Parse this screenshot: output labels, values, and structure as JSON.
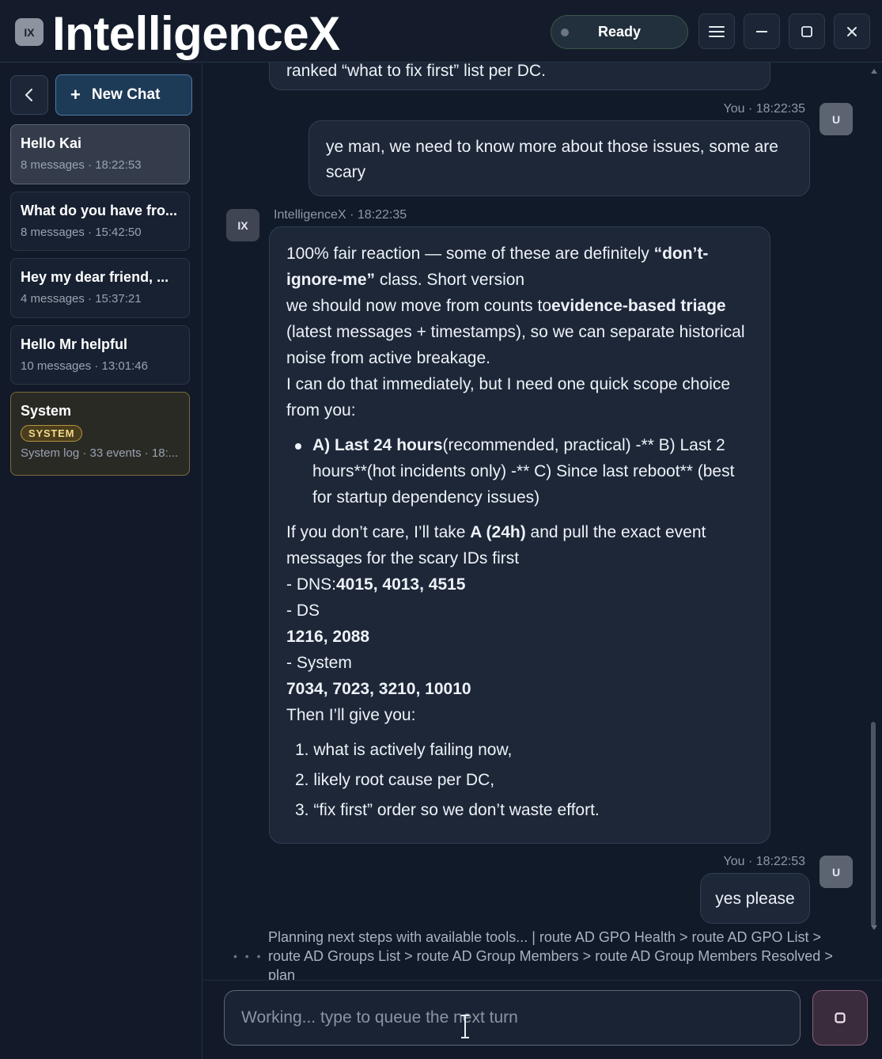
{
  "app": {
    "badge": "IX",
    "title": "IntelligenceX"
  },
  "status": {
    "label": "Ready"
  },
  "window_controls": [
    "menu-icon",
    "minimize-icon",
    "maximize-icon",
    "close-icon"
  ],
  "sidebar": {
    "back_icon": "chevron-left-icon",
    "new_chat_label": "New Chat",
    "chats": [
      {
        "title": "Hello Kai",
        "meta": "8 messages · 18:22:53",
        "active": true
      },
      {
        "title": "What do you have fro...",
        "meta": "8 messages · 15:42:50"
      },
      {
        "title": "Hey my dear friend, ...",
        "meta": "4 messages · 15:37:21"
      },
      {
        "title": "Hello Mr helpful",
        "meta": "10 messages · 13:01:46"
      },
      {
        "title": "System",
        "badge": "SYSTEM",
        "meta": "System log · 33 events · 18:..."
      }
    ]
  },
  "conversation": {
    "prev_tail": "ranked “what to fix first” list per DC.",
    "user_message_1": {
      "meta": "You · 18:22:35",
      "avatar": "U",
      "text": "ye man, we need to know more about those issues, some are scary"
    },
    "assistant_message": {
      "meta": "IntelligenceX · 18:22:35",
      "avatar": "IX",
      "intro_1": "100% fair reaction — some of these are definitely ",
      "intro_1_bold": "“don’t-ignore-me”",
      "intro_1_end": " class. Short version",
      "intro_2": "we should now move from counts to",
      "intro_2_bold": "evidence-based triage",
      "intro_2_end": " (latest messages + timestamps), so we can separate historical noise from active breakage.",
      "intro_3": "I can do that immediately, but I need one quick scope choice from you:",
      "bullet_bold": "A) Last 24 hours",
      "bullet_rest": "(recommended, practical) -** B) Last 2 hours**(hot incidents only) -** C) Since last reboot** (best for startup dependency issues)",
      "follow_1": "If you don’t care, I’ll take ",
      "follow_1_bold": "A (24h)",
      "follow_1_end": " and pull the exact event messages for the scary IDs first",
      "dns_prefix": "- DNS:",
      "dns_ids": "4015, 4013, 4515",
      "ds_prefix": "- DS",
      "ds_ids": "1216, 2088",
      "system_prefix": "- System",
      "system_ids": "7034, 7023, 3210, 10010",
      "then_line": "Then I’ll give you:",
      "steps": [
        "1. what is actively failing now,",
        "2. likely root cause per DC,",
        "3. “fix first” order so we don’t waste effort."
      ]
    },
    "user_message_2": {
      "meta": "You · 18:22:53",
      "avatar": "U",
      "text": "yes please"
    },
    "progress": {
      "dots": "• • •",
      "text": "Planning next steps with available tools... | route AD GPO Health > route AD GPO List > route AD Groups List > route AD Group Members > route AD Group Members Resolved > plan"
    }
  },
  "composer": {
    "placeholder": "Working... type to queue the next turn",
    "value": "",
    "stop_icon": "stop-icon"
  }
}
